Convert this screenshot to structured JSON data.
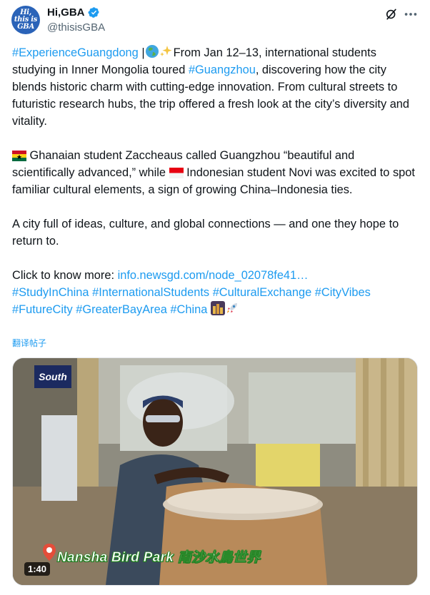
{
  "account": {
    "avatar_text": "Hi,\nthis is\nGBA",
    "name": "Hi,GBA",
    "handle": "@thisisGBA"
  },
  "icons": {
    "verified": "verified-badge-icon",
    "grok": "grok-icon",
    "more": "more-icon"
  },
  "post": {
    "p1": {
      "tag1": "#ExperienceGuangdong",
      "sep": " |",
      "t1": "From Jan 12–13, international students studying in Inner Mongolia toured ",
      "tag2": "#Guangzhou",
      "t2": ", discovering how the city blends historic charm with cutting-edge innovation. From cultural streets to futuristic research hubs, the trip offered a fresh look at the city’s diversity and vitality."
    },
    "p2": {
      "t1": " Ghanaian student Zaccheaus called Guangzhou “beautiful and scientifically advanced,” while ",
      "t2": " Indonesian student Novi was excited to spot familiar cultural elements, a sign of growing China–Indonesia ties."
    },
    "p3": "A city full of ideas, culture, and global connections — and one they hope to return to.",
    "p4": {
      "lead": "Click to know more: ",
      "link": "info.newsgd.com/node_02078fe41…",
      "tags": [
        "#StudyInChina",
        "#InternationalStudents",
        "#CulturalExchange",
        "#CityVibes",
        "#FutureCity",
        "#GreaterBayArea",
        "#China"
      ]
    },
    "translate": "翻译帖子"
  },
  "video": {
    "duration": "1:40",
    "logo": "South",
    "caption": "Nansha Bird Park 南沙水鳥世界"
  },
  "colors": {
    "accent": "#1d9bf0",
    "text": "#0f1419",
    "muted": "#536471"
  }
}
